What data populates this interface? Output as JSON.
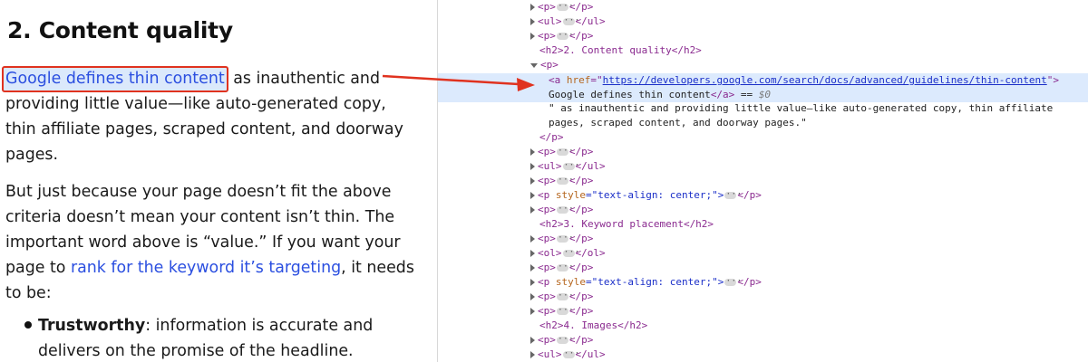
{
  "article": {
    "heading": "2. Content quality",
    "p1_link": "Google defines thin content",
    "p1_line1_rest": " as inauthentic and",
    "p1_line2": "providing little value—like auto-generated copy,",
    "p1_line3": "thin affiliate pages, scraped content, and doorway",
    "p1_line4": "pages.",
    "p2_line1": "But just because your page doesn’t fit the above",
    "p2_line2": "criteria doesn’t mean your content isn’t thin. The",
    "p2_line3": "important word above is “value.” If you want your",
    "p2_line4_pre": "page to ",
    "p2_link": "rank for the keyword it’s targeting",
    "p2_line4_post": ", it needs",
    "p2_line5": "to be:",
    "list_item_bold": "Trustworthy",
    "list_item_line1_rest": ": information is accurate and",
    "list_item_line2": "delivers on the promise of the headline."
  },
  "devtools": {
    "rows": {
      "r1": {
        "open": "<p>",
        "close": "</p>"
      },
      "r2": {
        "open": "<ul>",
        "close": "</ul>"
      },
      "r3": {
        "open": "<p>",
        "close": "</p>"
      },
      "r4_text": "<h2>2. Content quality</h2>",
      "r5_open": "<p>",
      "r6": {
        "open_tag": "<a ",
        "attr_name": "href",
        "eq_quote": "=\"",
        "url": "https://developers.google.com/search/docs/advanced/guidelines/thin-content",
        "close_quote": "\">"
      },
      "r7": {
        "text": "Google defines thin content",
        "close_tag": "</a>",
        "eq": " == ",
        "ref": "$0"
      },
      "r8_text": "\" as inauthentic and providing little value—like auto-generated copy, thin affiliate",
      "r9_text": "pages, scraped content, and doorway pages.\"",
      "r10_close": "</p>",
      "r11": {
        "open": "<p>",
        "close": "</p>"
      },
      "r12": {
        "open": "<ul>",
        "close": "</ul>"
      },
      "r13": {
        "open": "<p>",
        "close": "</p>"
      },
      "r14": {
        "open": "<p ",
        "attr": "style",
        "val": "=\"text-align: center;\">",
        "close": "</p>"
      },
      "r15": {
        "open": "<p>",
        "close": "</p>"
      },
      "r16_text": "<h2>3. Keyword placement</h2>",
      "r17": {
        "open": "<p>",
        "close": "</p>"
      },
      "r18": {
        "open": "<ol>",
        "close": "</ol>"
      },
      "r19": {
        "open": "<p>",
        "close": "</p>"
      },
      "r20": {
        "open": "<p ",
        "attr": "style",
        "val": "=\"text-align: center;\">",
        "close": "</p>"
      },
      "r21": {
        "open": "<p>",
        "close": "</p>"
      },
      "r22": {
        "open": "<p>",
        "close": "</p>"
      },
      "r23_text": "<h2>4. Images</h2>",
      "r24": {
        "open": "<p>",
        "close": "</p>"
      },
      "r25": {
        "open": "<ul>",
        "close": "</ul>"
      }
    },
    "gutter_dots": "···"
  },
  "colors": {
    "highlight_border": "#e0321f",
    "link": "#2b4fe0",
    "selected_row": "#dceafd",
    "tag": "#8a2a8f",
    "attr": "#b5651d",
    "value": "#1a2ec8"
  }
}
